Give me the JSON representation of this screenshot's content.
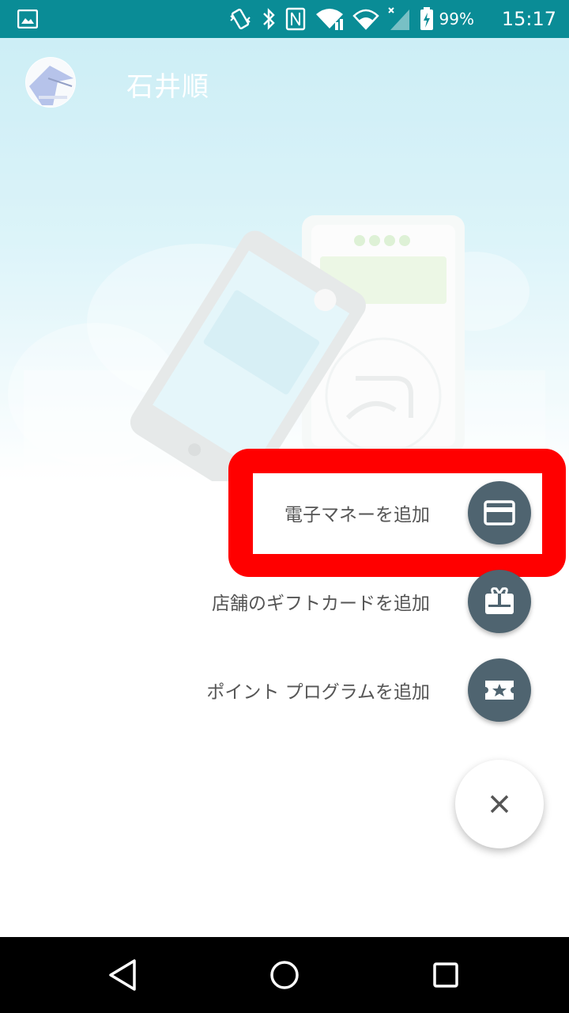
{
  "status_bar": {
    "battery_percent": "99%",
    "time": "15:17",
    "icons": [
      "image-notification-icon",
      "vibrate-icon",
      "bluetooth-icon",
      "nfc-icon",
      "wifi-icon",
      "wifi-icon",
      "signal-icon",
      "battery-charging-icon"
    ]
  },
  "header": {
    "user_name": "石井順"
  },
  "fab_menu": {
    "items": [
      {
        "label": "電子マネーを追加",
        "icon": "credit-card-icon"
      },
      {
        "label": "店舗のギフトカードを追加",
        "icon": "gift-card-icon"
      },
      {
        "label": "ポイント プログラムを追加",
        "icon": "ticket-star-icon"
      }
    ],
    "close_icon": "close-icon",
    "close_glyph": "✕"
  },
  "colors": {
    "status_bar": "#0a8c96",
    "fab": "#4f6470",
    "highlight": "#ff0000",
    "hero_top": "#b2e5f1"
  },
  "nav_bar": {
    "buttons": [
      "back-icon",
      "home-icon",
      "recent-apps-icon"
    ]
  }
}
